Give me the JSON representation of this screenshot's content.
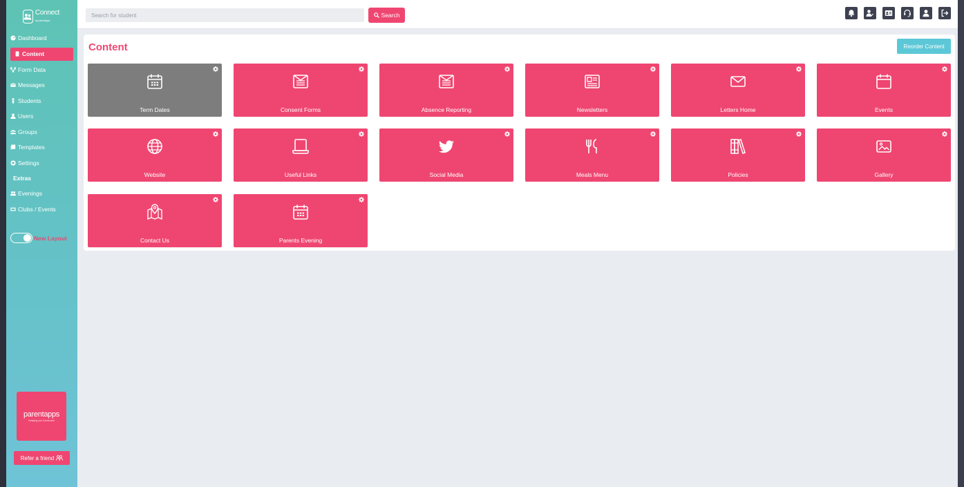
{
  "sidebar": {
    "logo_text": "Connect",
    "logo_sub": "by parentapps",
    "items": [
      {
        "label": "Dashboard",
        "icon": "dashboard-icon"
      },
      {
        "label": "Content",
        "icon": "content-icon",
        "active": true
      },
      {
        "label": "Form Data",
        "icon": "form-data-icon"
      },
      {
        "label": "Messages",
        "icon": "envelope-icon"
      },
      {
        "label": "Students",
        "icon": "student-icon"
      },
      {
        "label": "Users",
        "icon": "user-icon"
      },
      {
        "label": "Groups",
        "icon": "groups-icon"
      },
      {
        "label": "Templates",
        "icon": "templates-icon"
      },
      {
        "label": "Settings",
        "icon": "gear-icon"
      }
    ],
    "extras_heading": "Extras",
    "extras": [
      {
        "label": "Evenings",
        "icon": "evenings-icon"
      },
      {
        "label": "Clubs / Events",
        "icon": "clubs-icon"
      }
    ],
    "toggle_label": "New Layout",
    "brand": "parentapps",
    "brand_tag": "Keeping you Connected",
    "refer_label": "Refer a friend"
  },
  "topbar": {
    "search_placeholder": "Search for student",
    "search_button": "Search",
    "icons": [
      "bell-icon",
      "user-edit-icon",
      "id-card-icon",
      "support-icon",
      "profile-icon",
      "logout-icon"
    ]
  },
  "content": {
    "title": "Content",
    "reorder_label": "Reorder Content",
    "tiles": [
      {
        "label": "Term Dates",
        "icon": "calendar-icon",
        "color": "#7d7d7d"
      },
      {
        "label": "Consent Forms",
        "icon": "mail-form-icon",
        "color": "#ef4671"
      },
      {
        "label": "Absence Reporting",
        "icon": "mail-form-icon",
        "color": "#ef4671"
      },
      {
        "label": "Newsletters",
        "icon": "newspaper-icon",
        "color": "#ef4671"
      },
      {
        "label": "Letters Home",
        "icon": "envelope-icon",
        "color": "#ef4671"
      },
      {
        "label": "Events",
        "icon": "calendar-blank-icon",
        "color": "#ef4671"
      },
      {
        "label": "Website",
        "icon": "globe-icon",
        "color": "#ef4671"
      },
      {
        "label": "Useful Links",
        "icon": "laptop-icon",
        "color": "#ef4671"
      },
      {
        "label": "Social Media",
        "icon": "twitter-icon",
        "color": "#ef4671"
      },
      {
        "label": "Meals Menu",
        "icon": "fork-knife-icon",
        "color": "#ef4671"
      },
      {
        "label": "Policies",
        "icon": "books-icon",
        "color": "#ef4671"
      },
      {
        "label": "Gallery",
        "icon": "picture-icon",
        "color": "#ef4671"
      },
      {
        "label": "Contact Us",
        "icon": "map-pin-icon",
        "color": "#ef4671"
      },
      {
        "label": "Parents Evening",
        "icon": "calendar-icon",
        "color": "#ef4671"
      }
    ]
  },
  "colors": {
    "accent": "#ef4671",
    "teal": "#5cc8d7",
    "grey_tile": "#7d7d7d",
    "dark_icon": "#3d4150"
  }
}
